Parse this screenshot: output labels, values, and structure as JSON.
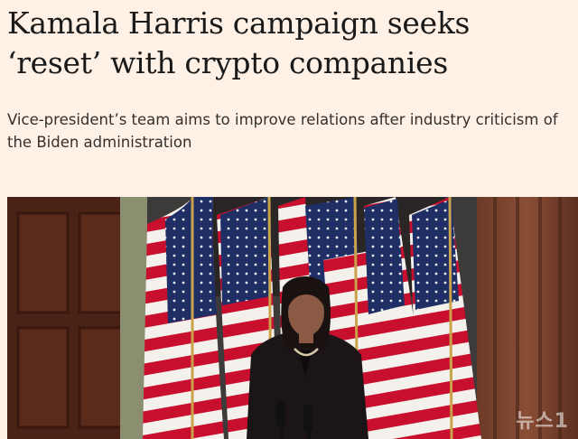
{
  "article": {
    "headline_line1": "Kamala Harris campaign seeks",
    "headline_line2": "‘reset’ with crypto companies",
    "standfirst": "Vice-president’s team aims to improve relations after industry criticism of the Biden administration"
  },
  "photo": {
    "watermark": "뉴스1",
    "colors": {
      "page_background": "#fff1e5",
      "flag_red": "#c8102e",
      "flag_blue": "#1f2f66",
      "wood": "#5a2a1a"
    }
  }
}
